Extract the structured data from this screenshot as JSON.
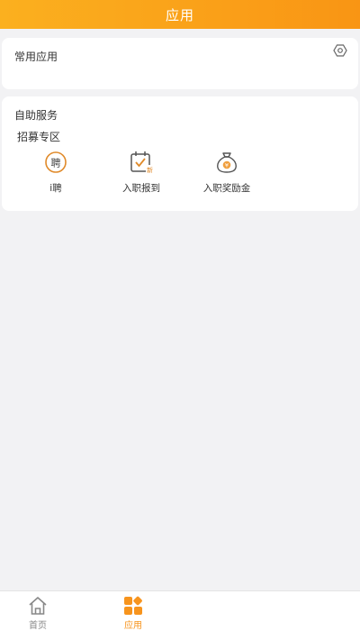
{
  "header": {
    "title": "应用"
  },
  "common_apps": {
    "title": "常用应用",
    "settings_icon": "settings-icon"
  },
  "self_service": {
    "title": "自助服务",
    "section_title": "招募专区",
    "apps": [
      {
        "label": "i聘",
        "icon": "pin-badge-icon",
        "badge_text": "聘"
      },
      {
        "label": "入职报到",
        "icon": "calendar-check-icon",
        "badge_text": "新"
      },
      {
        "label": "入职奖励金",
        "icon": "money-bag-icon",
        "badge_text": "¥"
      }
    ]
  },
  "tabbar": {
    "items": [
      {
        "label": "首页",
        "icon": "home-icon"
      },
      {
        "label": "应用",
        "icon": "apps-grid-icon",
        "active": true
      }
    ]
  },
  "colors": {
    "accent": "#f7941d",
    "header_start": "#fbb01f",
    "header_end": "#f99514",
    "background": "#f2f2f4"
  }
}
